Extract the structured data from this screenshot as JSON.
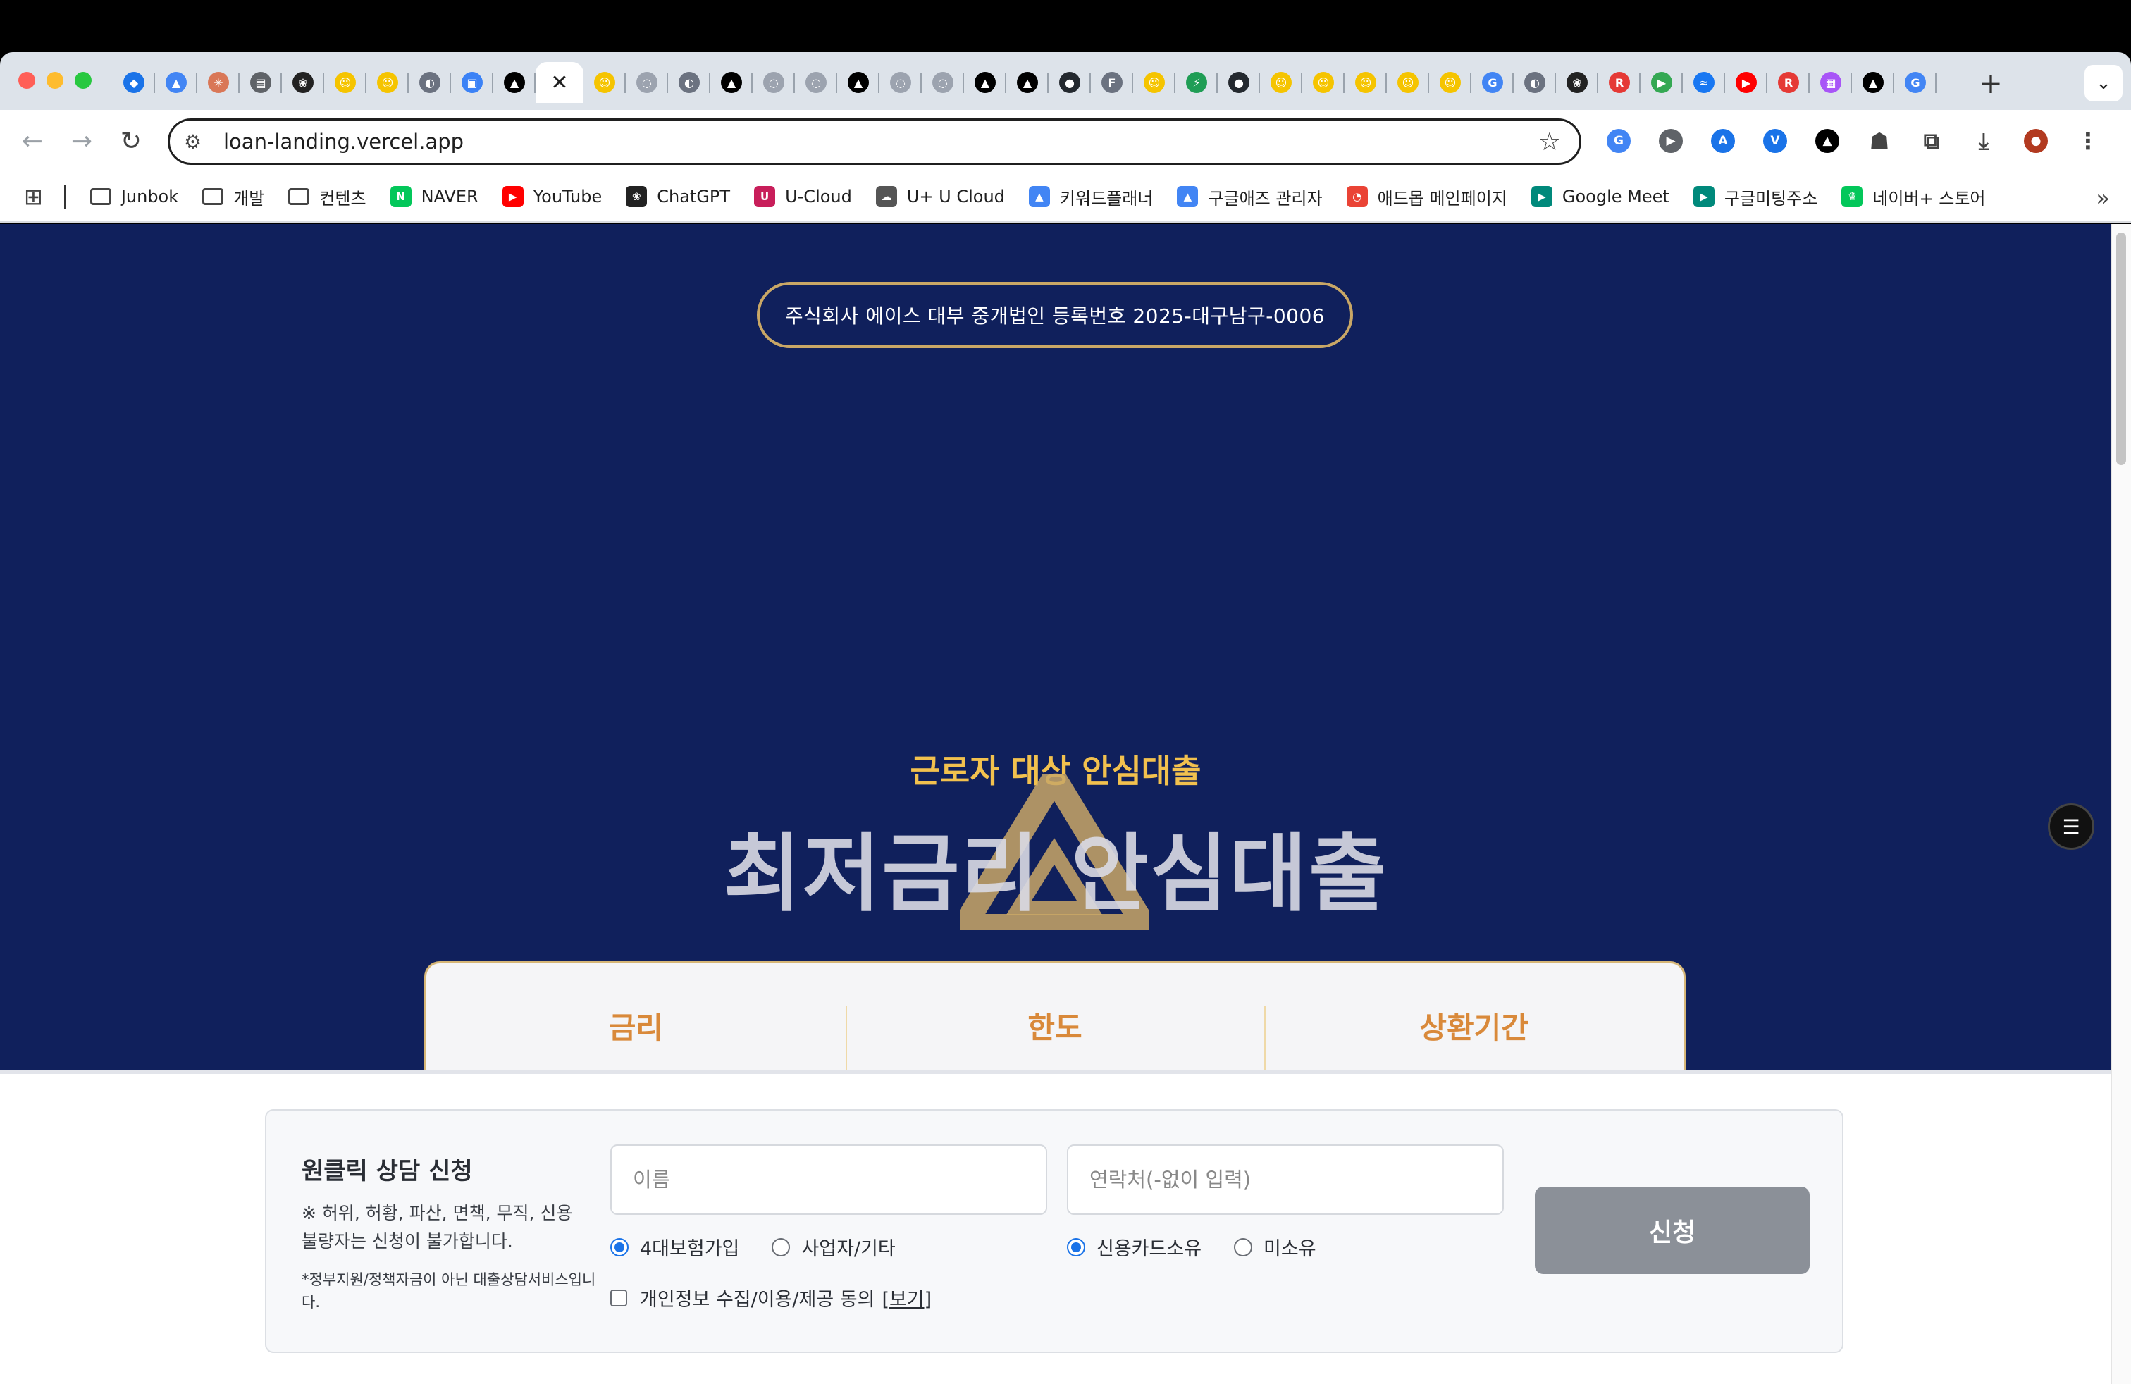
{
  "browser": {
    "tabs": [
      {
        "icon": "gem-icon",
        "color": "#1a73e8",
        "glyph": "◆"
      },
      {
        "icon": "google-ads-icon",
        "color": "#4285f4",
        "glyph": "▲"
      },
      {
        "icon": "claude-icon",
        "color": "#d97757",
        "glyph": "✳"
      },
      {
        "icon": "document-icon",
        "color": "#5f6368",
        "glyph": "▤"
      },
      {
        "icon": "chatgpt-icon",
        "color": "#222222",
        "glyph": "❀"
      },
      {
        "icon": "wrtn-icon",
        "color": "#f5c400",
        "glyph": "☺"
      },
      {
        "icon": "wrtn-icon",
        "color": "#f5c400",
        "glyph": "☺"
      },
      {
        "icon": "globe-icon",
        "color": "#6b7280",
        "glyph": "◐"
      },
      {
        "icon": "image-icon",
        "color": "#3b82f6",
        "glyph": "▣"
      },
      {
        "icon": "vercel-icon",
        "color": "#000000",
        "glyph": "▲"
      },
      {
        "icon": "close-icon",
        "active": true,
        "glyph": "✕"
      },
      {
        "icon": "wrtn-icon",
        "color": "#f5c400",
        "glyph": "☺"
      },
      {
        "icon": "loading-icon",
        "color": "#9ca3af",
        "glyph": "◌"
      },
      {
        "icon": "globe-icon",
        "color": "#6b7280",
        "glyph": "◐"
      },
      {
        "icon": "vercel-icon",
        "color": "#000000",
        "glyph": "▲"
      },
      {
        "icon": "loading-icon",
        "color": "#9ca3af",
        "glyph": "◌"
      },
      {
        "icon": "loading-icon",
        "color": "#9ca3af",
        "glyph": "◌"
      },
      {
        "icon": "vercel-icon",
        "color": "#000000",
        "glyph": "▲"
      },
      {
        "icon": "loading-icon",
        "color": "#9ca3af",
        "glyph": "◌"
      },
      {
        "icon": "loading-icon",
        "color": "#9ca3af",
        "glyph": "◌"
      },
      {
        "icon": "vercel-icon",
        "color": "#000000",
        "glyph": "▲"
      },
      {
        "icon": "vercel-icon",
        "color": "#000000",
        "glyph": "▲"
      },
      {
        "icon": "github-icon",
        "color": "#24292f",
        "glyph": "●"
      },
      {
        "icon": "f-icon",
        "color": "#6b7280",
        "glyph": "F"
      },
      {
        "icon": "wrtn-icon",
        "color": "#f5c400",
        "glyph": "☺"
      },
      {
        "icon": "supabase-icon",
        "color": "#1f9d55",
        "glyph": "⚡"
      },
      {
        "icon": "github-icon",
        "color": "#24292f",
        "glyph": "●"
      },
      {
        "icon": "wrtn-icon",
        "color": "#f5c400",
        "glyph": "☺"
      },
      {
        "icon": "wrtn-icon",
        "color": "#f5c400",
        "glyph": "☺"
      },
      {
        "icon": "wrtn-icon",
        "color": "#f5c400",
        "glyph": "☺"
      },
      {
        "icon": "wrtn-icon",
        "color": "#f5c400",
        "glyph": "☺"
      },
      {
        "icon": "wrtn-icon",
        "color": "#f5c400",
        "glyph": "☺"
      },
      {
        "icon": "google-icon",
        "color": "#4285f4",
        "glyph": "G"
      },
      {
        "icon": "globe-icon",
        "color": "#6b7280",
        "glyph": "◐"
      },
      {
        "icon": "chatgpt-icon",
        "color": "#222222",
        "glyph": "❀"
      },
      {
        "icon": "rc-icon",
        "color": "#e53935",
        "glyph": "R"
      },
      {
        "icon": "play-icon",
        "color": "#34a853",
        "glyph": "▶"
      },
      {
        "icon": "messenger-icon",
        "color": "#1877f2",
        "glyph": "≈"
      },
      {
        "icon": "youtube-icon",
        "color": "#ff0000",
        "glyph": "▶"
      },
      {
        "icon": "rc-icon",
        "color": "#e53935",
        "glyph": "R"
      },
      {
        "icon": "apps-grid-icon",
        "color": "#a855f7",
        "glyph": "▦"
      },
      {
        "icon": "vercel-icon",
        "color": "#000000",
        "glyph": "▲"
      },
      {
        "icon": "google-icon",
        "color": "#4285f4",
        "glyph": "G"
      }
    ],
    "url": "loan-landing.vercel.app",
    "extensions": [
      {
        "icon": "google-translate-icon",
        "color": "#4285f4",
        "glyph": "G"
      },
      {
        "icon": "video-icon",
        "color": "#5f6368",
        "glyph": "▶"
      },
      {
        "icon": "translate-icon",
        "color": "#1a73e8",
        "glyph": "A"
      },
      {
        "icon": "vuejs-icon",
        "color": "#1a73e8",
        "glyph": "V"
      },
      {
        "icon": "vercel-icon",
        "color": "#000000",
        "glyph": "▲"
      },
      {
        "icon": "robot-icon",
        "color": "#444444",
        "glyph": "☗"
      },
      {
        "icon": "puzzle-icon",
        "color": "#444444",
        "glyph": "⧉"
      },
      {
        "icon": "download-icon",
        "color": "#444444",
        "glyph": "⤓"
      },
      {
        "icon": "profile-avatar-icon",
        "color": "#b23a20",
        "glyph": "●"
      },
      {
        "icon": "kebab-menu-icon",
        "color": "#444444",
        "glyph": "⋮"
      }
    ],
    "bookmarks": [
      {
        "label": "Junbok",
        "icon": "folder-icon",
        "type": "folder"
      },
      {
        "label": "개발",
        "icon": "folder-icon",
        "type": "folder"
      },
      {
        "label": "컨텐츠",
        "icon": "folder-icon",
        "type": "folder"
      },
      {
        "label": "NAVER",
        "icon": "naver-icon",
        "color": "#03c75a",
        "glyph": "N"
      },
      {
        "label": "YouTube",
        "icon": "youtube-icon",
        "color": "#ff0000",
        "glyph": "▶"
      },
      {
        "label": "ChatGPT",
        "icon": "chatgpt-icon",
        "color": "#222222",
        "glyph": "❀"
      },
      {
        "label": "U-Cloud",
        "icon": "u-cloud-icon",
        "color": "#c81e5a",
        "glyph": "U"
      },
      {
        "label": "U+ U Cloud",
        "icon": "cloud-icon",
        "color": "#555555",
        "glyph": "☁"
      },
      {
        "label": "키워드플래너",
        "icon": "google-ads-icon",
        "color": "#4285f4",
        "glyph": "▲"
      },
      {
        "label": "구글애즈 관리자",
        "icon": "google-ads-icon",
        "color": "#4285f4",
        "glyph": "▲"
      },
      {
        "label": "애드몹 메인페이지",
        "icon": "admob-icon",
        "color": "#ea4335",
        "glyph": "◔"
      },
      {
        "label": "Google Meet",
        "icon": "google-meet-icon",
        "color": "#00897b",
        "glyph": "▶"
      },
      {
        "label": "구글미팅주소",
        "icon": "google-meet-icon",
        "color": "#00897b",
        "glyph": "▶"
      },
      {
        "label": "네이버+ 스토어",
        "icon": "trophy-icon",
        "color": "#03c75a",
        "glyph": "♛"
      }
    ]
  },
  "page": {
    "colors": {
      "hero": "#10205c",
      "gold": "#c9a766",
      "accent_text": "#f2c14e",
      "stat_text": "#d9893a"
    },
    "badge": "주식회사 에이스 대부 중개법인 등록번호 2025-대구남구-0006",
    "subtitle": "근로자 대상 안심대출",
    "headline": "최저금리 안심대출",
    "stats": [
      "금리",
      "한도",
      "상환기간"
    ],
    "consult": {
      "title": "원클릭 상담 신청",
      "warning": "※ 허위, 허황, 파산, 면책, 무직, 신용불량자는 신청이 불가합니다.",
      "note": "*정부지원/정책자금이 아닌 대출상담서비스입니다.",
      "name_placeholder": "이름",
      "phone_placeholder": "연락처(-없이 입력)",
      "job_options": [
        {
          "label": "4대보험가입",
          "selected": true
        },
        {
          "label": "사업자/기타",
          "selected": false
        }
      ],
      "card_options": [
        {
          "label": "신용카드소유",
          "selected": true
        },
        {
          "label": "미소유",
          "selected": false
        }
      ],
      "agree_label": "개인정보 수집/이용/제공 동의",
      "agree_link": "[보기]",
      "agree_checked": false,
      "submit_label": "신청"
    }
  }
}
